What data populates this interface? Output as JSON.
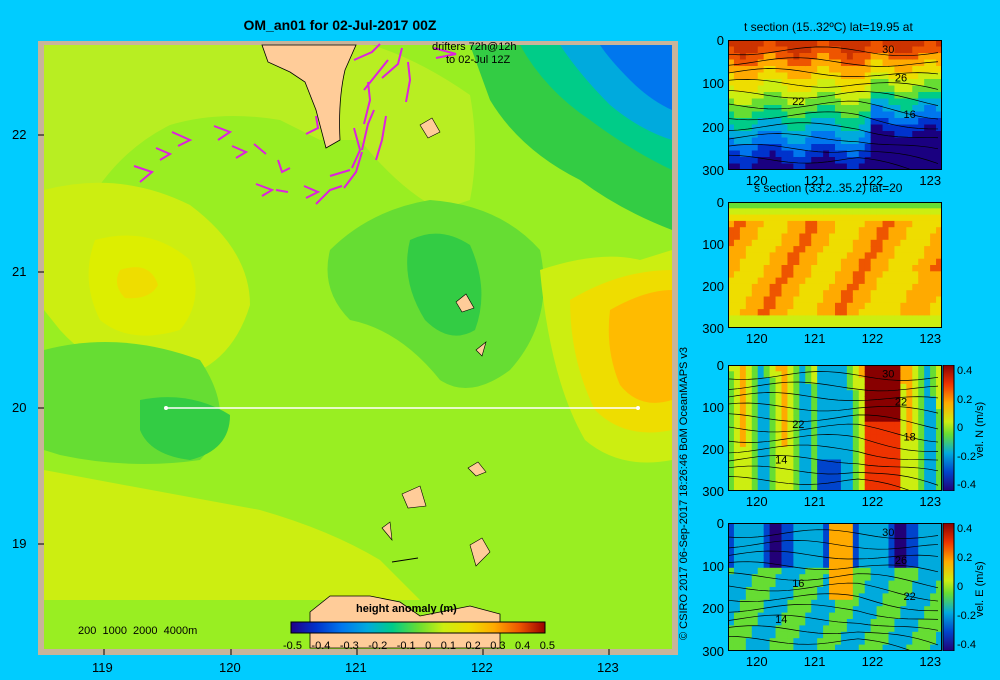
{
  "title": "OM_an01 for 02-Jul-2017 00Z",
  "map": {
    "drifter_label_1": "drifters 72h@12h",
    "drifter_label_2": "to 02-Jul 12Z",
    "depth_legend": "200  1000  2000  4000m",
    "lon_ticks": [
      "119",
      "120",
      "121",
      "122",
      "123"
    ],
    "lat_ticks": [
      "22",
      "21",
      "20",
      "19"
    ],
    "colorbar_title": "height anomaly  (m)",
    "colorbar_ticks": [
      "-0.5",
      "-0.4",
      "-0.3",
      "-0.2",
      "-0.1",
      "0",
      "0.1",
      "0.2",
      "0.3",
      "0.4",
      "0.5"
    ],
    "section_line": {
      "lat": 20,
      "lon_start": 119.5,
      "lon_end": 123.2
    }
  },
  "credit": "© CSIRO 2017   06-Sep-2017 18:26:46 BoM OceanMAPS v3",
  "chart_data": [
    {
      "type": "heatmap",
      "title": "OM_an01 for 02-Jul-2017 00Z",
      "xlim": [
        118.5,
        123.5
      ],
      "ylim": [
        18.3,
        22.7
      ],
      "colorbar": {
        "label": "height anomaly  (m)",
        "range": [
          -0.5,
          0.5
        ]
      }
    },
    {
      "type": "heatmap",
      "title": "t section (15..32ºC) lat=19.95 at",
      "xlim": [
        119.5,
        123.2
      ],
      "ylim": [
        300,
        0
      ],
      "x_ticks": [
        "120",
        "121",
        "122",
        "123"
      ],
      "y_ticks": [
        "0",
        "100",
        "200",
        "300"
      ],
      "contour_labels": [
        "30",
        "26",
        "22",
        "16"
      ]
    },
    {
      "type": "heatmap",
      "title": "s section (33.2..35.2) lat=20",
      "xlim": [
        119.5,
        123.2
      ],
      "ylim": [
        300,
        0
      ],
      "x_ticks": [
        "120",
        "121",
        "122",
        "123"
      ],
      "y_ticks": [
        "0",
        "100",
        "200",
        "300"
      ]
    },
    {
      "type": "heatmap",
      "xlim": [
        119.5,
        123.2
      ],
      "ylim": [
        300,
        0
      ],
      "x_ticks": [
        "120",
        "121",
        "122",
        "123"
      ],
      "y_ticks": [
        "0",
        "100",
        "200",
        "300"
      ],
      "contour_labels": [
        "30",
        "22",
        "22",
        "18",
        "14"
      ],
      "colorbar": {
        "label": "vel. N (m/s)",
        "range": [
          -0.4,
          0.4
        ],
        "ticks": [
          "0.4",
          "0.2",
          "0",
          "-0.2",
          "-0.4"
        ]
      }
    },
    {
      "type": "heatmap",
      "xlim": [
        119.5,
        123.2
      ],
      "ylim": [
        300,
        0
      ],
      "x_ticks": [
        "120",
        "121",
        "122",
        "123"
      ],
      "y_ticks": [
        "0",
        "100",
        "200",
        "300"
      ],
      "contour_labels": [
        "30",
        "26",
        "16",
        "22",
        "14"
      ],
      "colorbar": {
        "label": "vel. E (m/s)",
        "range": [
          -0.4,
          0.4
        ],
        "ticks": [
          "0.4",
          "0.2",
          "0",
          "-0.2",
          "-0.4"
        ]
      }
    }
  ]
}
